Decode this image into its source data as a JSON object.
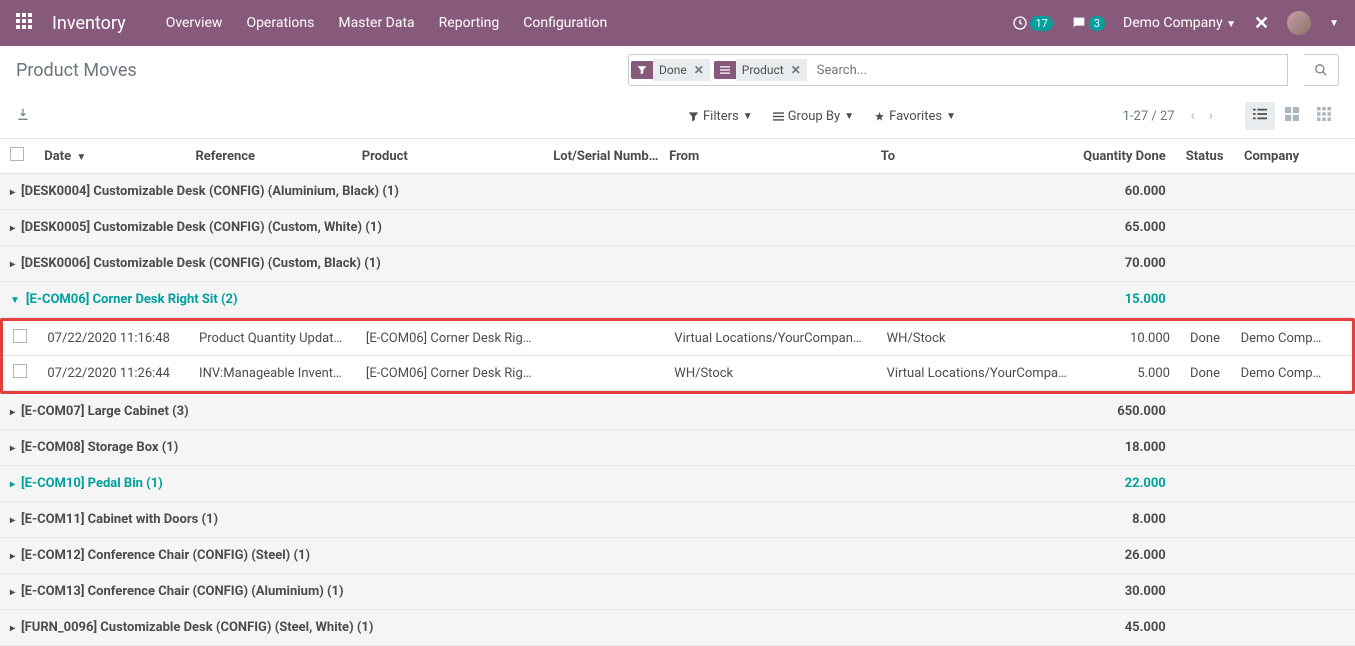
{
  "header": {
    "module": "Inventory",
    "nav": [
      "Overview",
      "Operations",
      "Master Data",
      "Reporting",
      "Configuration"
    ],
    "clock_badge": "17",
    "chat_badge": "3",
    "company": "Demo Company"
  },
  "breadcrumb": "Product Moves",
  "search": {
    "facet1_label": "Done",
    "facet2_label": "Product",
    "placeholder": "Search..."
  },
  "toolbar": {
    "filters": "Filters",
    "groupby": "Group By",
    "favorites": "Favorites",
    "pager": "1-27 / 27"
  },
  "columns": {
    "date": "Date",
    "reference": "Reference",
    "product": "Product",
    "lot": "Lot/Serial Numb…",
    "from": "From",
    "to": "To",
    "qty": "Quantity Done",
    "status": "Status",
    "company": "Company"
  },
  "groups": [
    {
      "title": "[DESK0004] Customizable Desk (CONFIG) (Aluminium, Black) (1)",
      "qty": "60.000",
      "expanded": false
    },
    {
      "title": "[DESK0005] Customizable Desk (CONFIG) (Custom, White) (1)",
      "qty": "65.000",
      "expanded": false
    },
    {
      "title": "[DESK0006] Customizable Desk (CONFIG) (Custom, Black) (1)",
      "qty": "70.000",
      "expanded": false
    },
    {
      "title": "[E-COM06] Corner Desk Right Sit (2)",
      "qty": "15.000",
      "expanded": true,
      "rows": [
        {
          "date": "07/22/2020 11:16:48",
          "ref": "Product Quantity Updated",
          "prod": "[E-COM06] Corner Desk Right …",
          "lot": "",
          "from": "Virtual Locations/YourCompany:…",
          "to": "WH/Stock",
          "qty": "10.000",
          "status": "Done",
          "company": "Demo Compa…"
        },
        {
          "date": "07/22/2020 11:26:44",
          "ref": "INV:Manageable Inventory",
          "prod": "[E-COM06] Corner Desk Right …",
          "lot": "",
          "from": "WH/Stock",
          "to": "Virtual Locations/YourCompany:…",
          "qty": "5.000",
          "status": "Done",
          "company": "Demo Compa…"
        }
      ]
    },
    {
      "title": "[E-COM07] Large Cabinet (3)",
      "qty": "650.000",
      "expanded": false
    },
    {
      "title": "[E-COM08] Storage Box (1)",
      "qty": "18.000",
      "expanded": false
    },
    {
      "title": "[E-COM10] Pedal Bin (1)",
      "qty": "22.000",
      "expanded": "teal"
    },
    {
      "title": "[E-COM11] Cabinet with Doors (1)",
      "qty": "8.000",
      "expanded": false
    },
    {
      "title": "[E-COM12] Conference Chair (CONFIG) (Steel) (1)",
      "qty": "26.000",
      "expanded": false
    },
    {
      "title": "[E-COM13] Conference Chair (CONFIG) (Aluminium) (1)",
      "qty": "30.000",
      "expanded": false
    },
    {
      "title": "[FURN_0096] Customizable Desk (CONFIG) (Steel, White) (1)",
      "qty": "45.000",
      "expanded": false
    }
  ]
}
